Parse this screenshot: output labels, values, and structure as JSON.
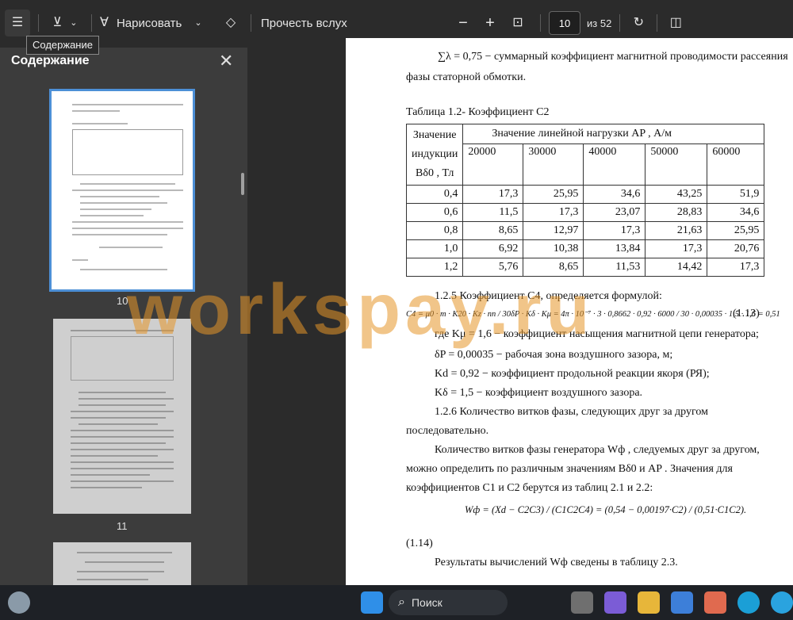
{
  "toolbar": {
    "draw_label": "Нарисовать",
    "read_aloud_label": "Прочесть вслух",
    "page_current": "10",
    "page_total": "из 52",
    "tooltip": "Содержание"
  },
  "sidebar": {
    "title": "Содержание",
    "thumbs": [
      {
        "label": "10"
      },
      {
        "label": "11"
      }
    ]
  },
  "document": {
    "line1a": "∑λ = 0,75 − суммарный коэффициент магнитной проводимости рассеяния",
    "line1b": "фазы статорной обмотки.",
    "table_caption": "Таблица 1.2- Коэффициент С2",
    "table": {
      "h1": "Значение",
      "h2": "индукции",
      "h3": "Bδ0 , Тл",
      "h_top": "Значение линейной нагрузки  AP , А/м",
      "cols": [
        "20000",
        "30000",
        "40000",
        "50000",
        "60000"
      ],
      "rows": [
        [
          "0,4",
          "17,3",
          "25,95",
          "34,6",
          "43,25",
          "51,9"
        ],
        [
          "0,6",
          "11,5",
          "17,3",
          "23,07",
          "28,83",
          "34,6"
        ],
        [
          "0,8",
          "8,65",
          "12,97",
          "17,3",
          "21,63",
          "25,95"
        ],
        [
          "1,0",
          "6,92",
          "10,38",
          "13,84",
          "17,3",
          "20,76"
        ],
        [
          "1,2",
          "5,76",
          "8,65",
          "11,53",
          "14,42",
          "17,3"
        ]
      ]
    },
    "sec125": "1.2.5 Коэффициент C4, определяется формулой:",
    "formula": "C4 = μ0 · m · K20 · Kz · nn / 30δP · Kδ · Kμ = 4π · 10⁻⁷ · 3 · 0,8662 · 0,92 · 6000 / 30 · 0,00035 · 1,5 · 1,6 = 0,51",
    "eq113": "(1.13)",
    "where1": "где Kμ = 1,6 − коэффициент насыщения магнитной цепи генератора;",
    "where2": "δP = 0,00035 − рабочая зона воздушного зазора, м;",
    "where3": "Kd = 0,92 − коэффициент продольной реакции якоря (РЯ);",
    "where4": "Kδ = 1,5 − коэффициент воздушного зазора.",
    "sec126a": "1.2.6   Количество   витков   фазы,   следующих   друг   за   другом",
    "sec126b": "последовательно.",
    "para1a": "Количество витков фазы генератора  Wф , следуемых друг за другом,",
    "para1b": "можно определить по различным значениям  Bδ0  и  AP .  Значения для",
    "para1c": "коэффициентов C1 и C2 берутся из таблиц 2.1 и 2.2:",
    "formula2": "Wф = (Xd − C2C3) / (C1C2C4) = (0,54 − 0,00197·C2) / (0,51·C1C2).",
    "eq114": "(1.14)",
    "result": "Результаты вычислений  Wф  сведены в таблицу 2.3."
  },
  "watermark": "workspay.ru",
  "taskbar": {
    "search_label": "Поиск"
  }
}
